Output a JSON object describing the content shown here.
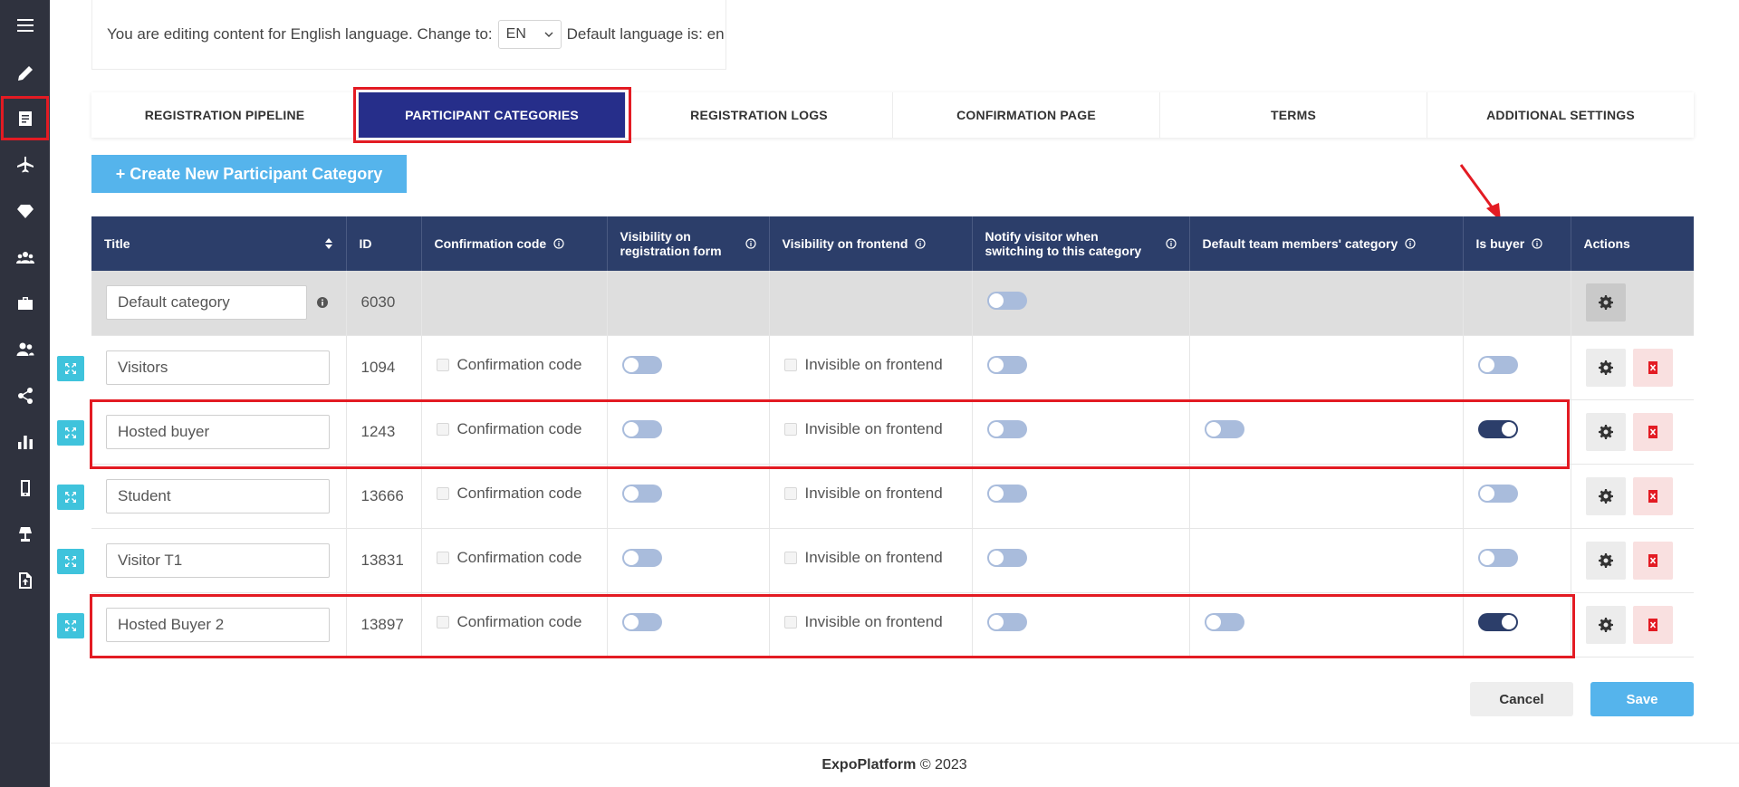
{
  "sidebar": {
    "items": [
      {
        "icon": "menu-icon"
      },
      {
        "icon": "pencil-icon"
      },
      {
        "icon": "document-icon",
        "active": true
      },
      {
        "icon": "airplane-icon"
      },
      {
        "icon": "diamond-icon"
      },
      {
        "icon": "group-icon"
      },
      {
        "icon": "briefcase-icon"
      },
      {
        "icon": "users-icon"
      },
      {
        "icon": "share-icon"
      },
      {
        "icon": "bar-chart-icon"
      },
      {
        "icon": "mobile-icon"
      },
      {
        "icon": "lamp-icon"
      },
      {
        "icon": "file-upload-icon"
      }
    ]
  },
  "language": {
    "prefix": "You are editing content for English language. Change to:",
    "selected": "EN",
    "suffix": "Default language is: en"
  },
  "tabs": [
    {
      "label": "REGISTRATION PIPELINE"
    },
    {
      "label": "PARTICIPANT CATEGORIES",
      "active": true
    },
    {
      "label": "REGISTRATION LOGS"
    },
    {
      "label": "CONFIRMATION PAGE"
    },
    {
      "label": "TERMS"
    },
    {
      "label": "ADDITIONAL SETTINGS"
    }
  ],
  "create_button": "+  Create New Participant Category",
  "table": {
    "headers": {
      "title": "Title",
      "id": "ID",
      "confirmation": "Confirmation code",
      "visibility_form": "Visibility on registration form",
      "visibility_frontend": "Visibility on frontend",
      "notify": "Notify visitor when switching to this category",
      "default_team": "Default team members' category",
      "is_buyer": "Is buyer",
      "actions": "Actions"
    },
    "default_row": {
      "title": "Default category",
      "id": "6030",
      "notify": false
    },
    "rows": [
      {
        "title": "Visitors",
        "id": "1094",
        "confirmation_label": "Confirmation code",
        "visibility_form": false,
        "frontend_label": "Invisible on frontend",
        "notify": false,
        "default_team": null,
        "is_buyer": false
      },
      {
        "title": "Hosted buyer",
        "id": "1243",
        "confirmation_label": "Confirmation code",
        "visibility_form": false,
        "frontend_label": "Invisible on frontend",
        "notify": false,
        "default_team": false,
        "is_buyer": true
      },
      {
        "title": "Student",
        "id": "13666",
        "confirmation_label": "Confirmation code",
        "visibility_form": false,
        "frontend_label": "Invisible on frontend",
        "notify": false,
        "default_team": null,
        "is_buyer": false
      },
      {
        "title": "Visitor T1",
        "id": "13831",
        "confirmation_label": "Confirmation code",
        "visibility_form": false,
        "frontend_label": "Invisible on frontend",
        "notify": false,
        "default_team": null,
        "is_buyer": false
      },
      {
        "title": "Hosted Buyer 2",
        "id": "13897",
        "confirmation_label": "Confirmation code",
        "visibility_form": false,
        "frontend_label": "Invisible on frontend",
        "notify": false,
        "default_team": false,
        "is_buyer": true
      }
    ]
  },
  "buttons": {
    "cancel": "Cancel",
    "save": "Save"
  },
  "footer": {
    "brand": "ExpoPlatform",
    "copyright": "© 2023"
  },
  "colors": {
    "accent": "#55b4ec",
    "header": "#2c3e6a",
    "active_tab": "#262e8a",
    "highlight": "#e31b23",
    "sidebar": "#2f323e"
  }
}
